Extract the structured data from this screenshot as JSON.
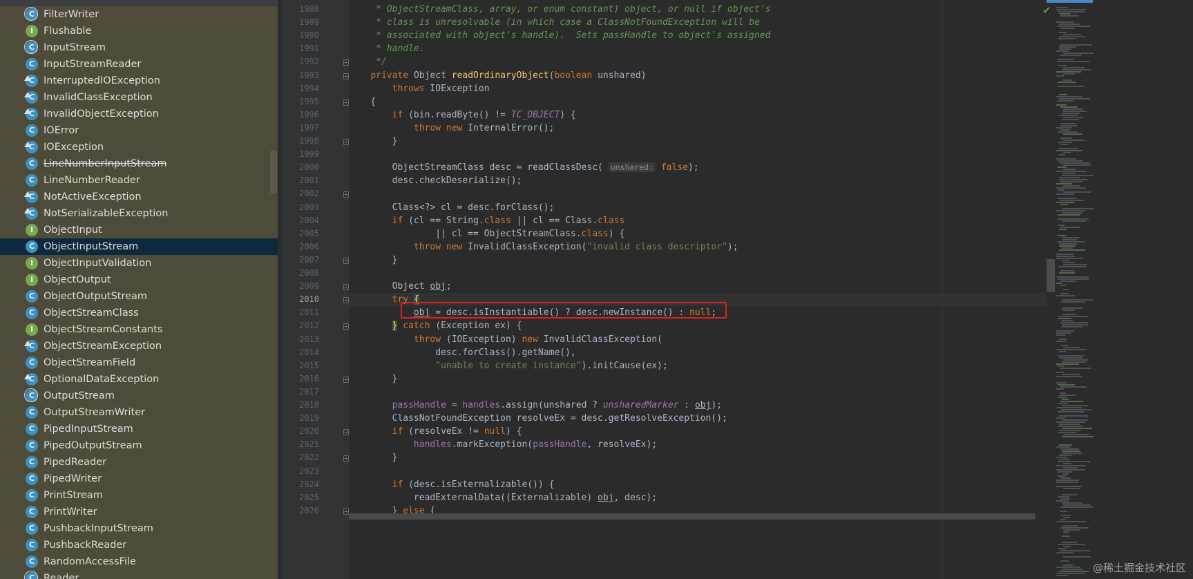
{
  "project_tree": {
    "items": [
      {
        "label": "FilterWriter",
        "kind": "abstract-class"
      },
      {
        "label": "Flushable",
        "kind": "interface"
      },
      {
        "label": "InputStream",
        "kind": "abstract-class"
      },
      {
        "label": "InputStreamReader",
        "kind": "class"
      },
      {
        "label": "InterruptedIOException",
        "kind": "exception"
      },
      {
        "label": "InvalidClassException",
        "kind": "exception"
      },
      {
        "label": "InvalidObjectException",
        "kind": "exception"
      },
      {
        "label": "IOError",
        "kind": "class"
      },
      {
        "label": "IOException",
        "kind": "exception"
      },
      {
        "label": "LineNumberInputStream",
        "kind": "class",
        "deprecated": true
      },
      {
        "label": "LineNumberReader",
        "kind": "class"
      },
      {
        "label": "NotActiveException",
        "kind": "exception"
      },
      {
        "label": "NotSerializableException",
        "kind": "exception"
      },
      {
        "label": "ObjectInput",
        "kind": "interface"
      },
      {
        "label": "ObjectInputStream",
        "kind": "class",
        "selected": true
      },
      {
        "label": "ObjectInputValidation",
        "kind": "interface"
      },
      {
        "label": "ObjectOutput",
        "kind": "interface"
      },
      {
        "label": "ObjectOutputStream",
        "kind": "class"
      },
      {
        "label": "ObjectStreamClass",
        "kind": "class"
      },
      {
        "label": "ObjectStreamConstants",
        "kind": "interface"
      },
      {
        "label": "ObjectStreamException",
        "kind": "exception"
      },
      {
        "label": "ObjectStreamField",
        "kind": "class"
      },
      {
        "label": "OptionalDataException",
        "kind": "exception"
      },
      {
        "label": "OutputStream",
        "kind": "abstract-class"
      },
      {
        "label": "OutputStreamWriter",
        "kind": "class"
      },
      {
        "label": "PipedInputStream",
        "kind": "class"
      },
      {
        "label": "PipedOutputStream",
        "kind": "class"
      },
      {
        "label": "PipedReader",
        "kind": "class"
      },
      {
        "label": "PipedWriter",
        "kind": "class"
      },
      {
        "label": "PrintStream",
        "kind": "class"
      },
      {
        "label": "PrintWriter",
        "kind": "class"
      },
      {
        "label": "PushbackInputStream",
        "kind": "class"
      },
      {
        "label": "PushbackReader",
        "kind": "class"
      },
      {
        "label": "RandomAccessFile",
        "kind": "class"
      },
      {
        "label": "Reader",
        "kind": "abstract-class"
      }
    ],
    "icon_letters": {
      "class": "C",
      "interface": "I"
    }
  },
  "editor": {
    "current_line": "2010",
    "lines": [
      {
        "n": "1988",
        "t": [
          [
            "cm",
            "     * ObjectStreamClass, array, or enum constant) object, or null if object's"
          ]
        ]
      },
      {
        "n": "1989",
        "t": [
          [
            "cm",
            "     * class is unresolvable (in which case a ClassNotFoundException will be"
          ]
        ]
      },
      {
        "n": "1990",
        "t": [
          [
            "cm",
            "     * associated with object's handle).  Sets passHandle to object's assigned"
          ]
        ]
      },
      {
        "n": "1991",
        "t": [
          [
            "cm",
            "     * handle."
          ]
        ]
      },
      {
        "n": "1992",
        "t": [
          [
            "cm",
            "     */"
          ]
        ]
      },
      {
        "n": "1993",
        "t": [
          [
            "",
            "    "
          ],
          [
            "kw",
            "private "
          ],
          [
            "",
            "Object "
          ],
          [
            "fn",
            "readOrdinaryObject"
          ],
          [
            "",
            "("
          ],
          [
            "kw",
            "boolean "
          ],
          [
            "",
            "unshared)"
          ]
        ]
      },
      {
        "n": "1994",
        "t": [
          [
            "",
            "        "
          ],
          [
            "kw",
            "throws "
          ],
          [
            "",
            "IOException"
          ]
        ]
      },
      {
        "n": "1995",
        "t": [
          [
            "",
            "    {"
          ]
        ]
      },
      {
        "n": "1996",
        "t": [
          [
            "",
            "        "
          ],
          [
            "kw",
            "if "
          ],
          [
            "",
            "(bin.readByte() != "
          ],
          [
            "ifld",
            "TC_OBJECT"
          ],
          [
            "",
            ") {"
          ]
        ]
      },
      {
        "n": "1997",
        "t": [
          [
            "",
            "            "
          ],
          [
            "kw",
            "throw new "
          ],
          [
            "",
            "InternalError();"
          ]
        ]
      },
      {
        "n": "1998",
        "t": [
          [
            "",
            "        }"
          ]
        ]
      },
      {
        "n": "1999",
        "t": [
          [
            "",
            ""
          ]
        ]
      },
      {
        "n": "2000",
        "t": [
          [
            "",
            "        ObjectStreamClass desc = readClassDesc( "
          ],
          [
            "hint",
            "unshared:"
          ],
          [
            "",
            " "
          ],
          [
            "kw",
            "false"
          ],
          [
            "",
            ");"
          ]
        ]
      },
      {
        "n": "2001",
        "t": [
          [
            "",
            "        desc.checkDeserialize();"
          ]
        ]
      },
      {
        "n": "2002",
        "t": [
          [
            "",
            ""
          ]
        ]
      },
      {
        "n": "2003",
        "t": [
          [
            "",
            "        Class<?> cl = desc.forClass();"
          ]
        ]
      },
      {
        "n": "2004",
        "t": [
          [
            "",
            "        "
          ],
          [
            "kw",
            "if "
          ],
          [
            "",
            "(cl == String."
          ],
          [
            "kw",
            "class "
          ],
          [
            "",
            "|| cl == Class."
          ],
          [
            "kw",
            "class"
          ]
        ]
      },
      {
        "n": "2005",
        "t": [
          [
            "",
            "                || cl == ObjectStreamClass."
          ],
          [
            "kw",
            "class"
          ],
          [
            "",
            ") {"
          ]
        ]
      },
      {
        "n": "2006",
        "t": [
          [
            "",
            "            "
          ],
          [
            "kw",
            "throw new "
          ],
          [
            "",
            "InvalidClassException("
          ],
          [
            "str",
            "\"invalid class descriptor\""
          ],
          [
            "",
            ");"
          ]
        ]
      },
      {
        "n": "2007",
        "t": [
          [
            "",
            "        }"
          ]
        ]
      },
      {
        "n": "2008",
        "t": [
          [
            "",
            ""
          ]
        ]
      },
      {
        "n": "2009",
        "t": [
          [
            "",
            "        Object "
          ],
          [
            "ul",
            "obj"
          ],
          [
            "",
            ";"
          ]
        ]
      },
      {
        "n": "2010",
        "t": [
          [
            "",
            "        "
          ],
          [
            "kw",
            "try "
          ],
          [
            "brace",
            "{"
          ]
        ]
      },
      {
        "n": "2011",
        "t": [
          [
            "",
            "            "
          ],
          [
            "ul",
            "obj"
          ],
          [
            "",
            " = desc.isInstantiable() ? desc.newInstance() : "
          ],
          [
            "kw",
            "null"
          ],
          [
            "",
            ";"
          ]
        ]
      },
      {
        "n": "2012",
        "t": [
          [
            "",
            "        "
          ],
          [
            "brace",
            "}"
          ],
          [
            "",
            " "
          ],
          [
            "kw",
            "catch "
          ],
          [
            "",
            "(Exception ex) {"
          ]
        ]
      },
      {
        "n": "2013",
        "t": [
          [
            "",
            "            "
          ],
          [
            "kw",
            "throw "
          ],
          [
            "",
            "(IOException) "
          ],
          [
            "kw",
            "new "
          ],
          [
            "",
            "InvalidClassException("
          ]
        ]
      },
      {
        "n": "2014",
        "t": [
          [
            "",
            "                desc.forClass().getName(),"
          ]
        ]
      },
      {
        "n": "2015",
        "t": [
          [
            "",
            "                "
          ],
          [
            "str",
            "\"unable to create instance\""
          ],
          [
            "",
            ").initCause(ex);"
          ]
        ]
      },
      {
        "n": "2016",
        "t": [
          [
            "",
            "        }"
          ]
        ]
      },
      {
        "n": "2017",
        "t": [
          [
            "",
            ""
          ]
        ]
      },
      {
        "n": "2018",
        "t": [
          [
            "",
            "        "
          ],
          [
            "fld",
            "passHandle"
          ],
          [
            "",
            " = "
          ],
          [
            "fld",
            "handles"
          ],
          [
            "",
            ".assign(unshared ? "
          ],
          [
            "ifld",
            "unsharedMarker"
          ],
          [
            "",
            " : "
          ],
          [
            "ul",
            "obj"
          ],
          [
            "",
            ");"
          ]
        ]
      },
      {
        "n": "2019",
        "t": [
          [
            "",
            "        ClassNotFoundException resolveEx = desc.getResolveException();"
          ]
        ]
      },
      {
        "n": "2020",
        "t": [
          [
            "",
            "        "
          ],
          [
            "kw",
            "if "
          ],
          [
            "",
            "(resolveEx != "
          ],
          [
            "kw",
            "null"
          ],
          [
            "",
            ") {"
          ]
        ]
      },
      {
        "n": "2021",
        "t": [
          [
            "",
            "            "
          ],
          [
            "fld",
            "handles"
          ],
          [
            "",
            ".markException("
          ],
          [
            "fld",
            "passHandle"
          ],
          [
            "",
            ", resolveEx);"
          ]
        ]
      },
      {
        "n": "2022",
        "t": [
          [
            "",
            "        }"
          ]
        ]
      },
      {
        "n": "2023",
        "t": [
          [
            "",
            ""
          ]
        ]
      },
      {
        "n": "2024",
        "t": [
          [
            "",
            "        "
          ],
          [
            "kw",
            "if "
          ],
          [
            "",
            "(desc.isExternalizable()) {"
          ]
        ]
      },
      {
        "n": "2025",
        "t": [
          [
            "",
            "            readExternalData((Externalizable) "
          ],
          [
            "ul",
            "obj"
          ],
          [
            "",
            ", desc);"
          ]
        ]
      },
      {
        "n": "2026",
        "t": [
          [
            "",
            "        } "
          ],
          [
            "kw",
            "else "
          ],
          [
            "",
            "{"
          ]
        ]
      }
    ]
  },
  "watermark": "@稀土掘金技术社区",
  "status_icon": "check-icon"
}
